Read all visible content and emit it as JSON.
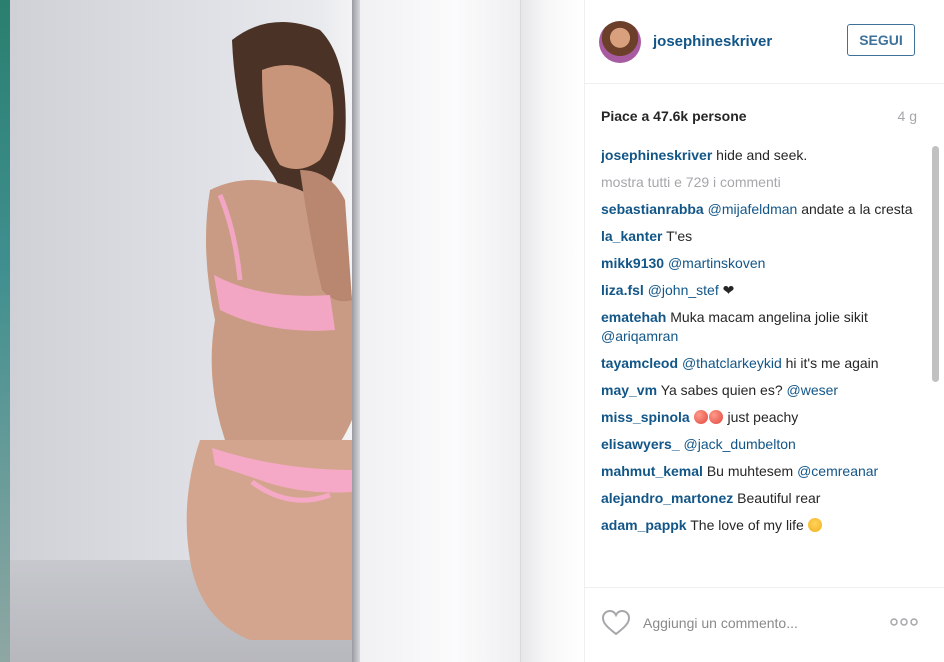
{
  "post": {
    "username": "josephineskriver",
    "follow_label": "SEGUI",
    "likes_text": "Piace a 47.6k persone",
    "time_ago": "4 g",
    "caption": {
      "user": "josephineskriver",
      "text": "hide and seek."
    },
    "show_all_comments": "mostra tutti e 729 i commenti",
    "comment_placeholder": "Aggiungi un commento...",
    "options_icon": "more-dots-icon",
    "like_icon": "heart-outline-icon"
  },
  "comments": [
    {
      "user": "sebastianrabba",
      "mention": "@mijafeldman",
      "text": "andate a la cresta"
    },
    {
      "user": "la_kanter",
      "text": "T'es"
    },
    {
      "user": "mikk9130",
      "mention": "@martinskoven"
    },
    {
      "user": "liza.fsl",
      "mention": "@john_stef",
      "text": "❤"
    },
    {
      "user": "ematehah",
      "text": "Muka macam angelina jolie sikit",
      "mention": "@ariqamran"
    },
    {
      "user": "tayamcleod",
      "mention": "@thatclarkeykid",
      "text": "hi it's me again"
    },
    {
      "user": "may_vm",
      "text": "Ya sabes quien es?",
      "mention": "@weser"
    },
    {
      "user": "miss_spinola",
      "text": "just peachy"
    },
    {
      "user": "elisawyers_",
      "mention": "@jack_dumbelton"
    },
    {
      "user": "mahmut_kemal",
      "text": "Bu muhtesem",
      "mention": "@cemreanar"
    },
    {
      "user": "alejandro_martonez",
      "text": "Beautiful rear"
    },
    {
      "user": "adam_pappk",
      "text": "The love of my life"
    }
  ]
}
